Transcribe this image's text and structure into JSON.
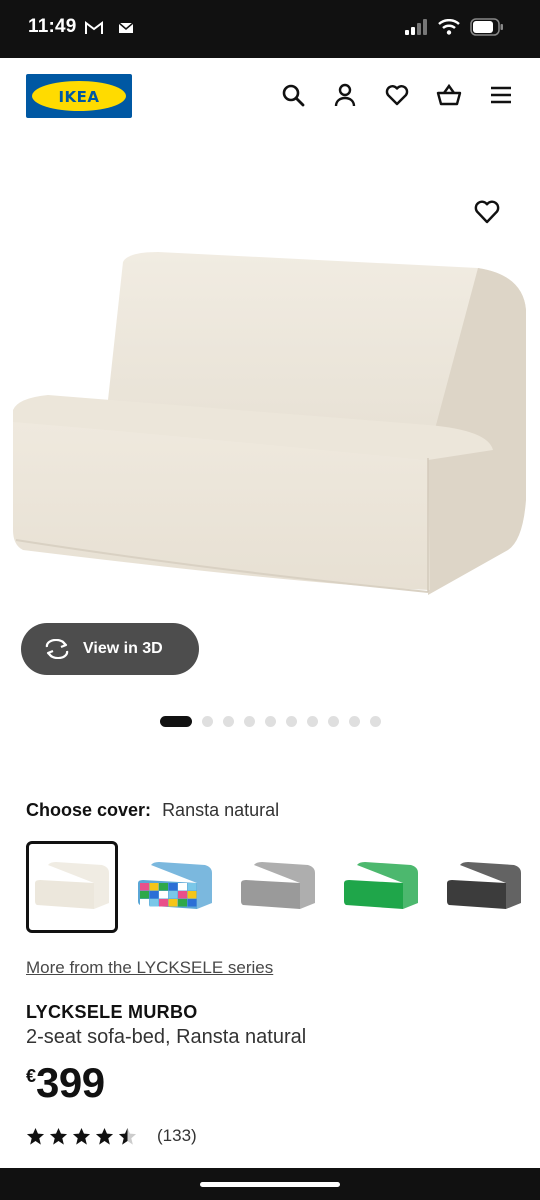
{
  "status_bar": {
    "time": "11:49",
    "left_icons": [
      "gmail-icon",
      "mail-icon"
    ],
    "right_icons": [
      "signal-icon",
      "wifi-icon",
      "battery-icon"
    ]
  },
  "header": {
    "logo_text": "IKEA",
    "icons": [
      "search-icon",
      "account-icon",
      "favorites-icon",
      "basket-icon",
      "menu-icon"
    ]
  },
  "hero": {
    "view3d_label": "View in 3D",
    "carousel": {
      "total": 10,
      "active": 1
    }
  },
  "cover": {
    "label": "Choose cover:",
    "value": "Ransta natural",
    "options": [
      {
        "name": "Ransta natural",
        "color": "#ece7dc",
        "selected": true
      },
      {
        "name": "multicolour",
        "color": "#5aa6d6",
        "selected": false
      },
      {
        "name": "grey",
        "color": "#9a9a9a",
        "selected": false
      },
      {
        "name": "green",
        "color": "#1fa64a",
        "selected": false
      },
      {
        "name": "dark grey",
        "color": "#3c3c3c",
        "selected": false
      }
    ]
  },
  "product": {
    "series_link": "More from the LYCKSELE series",
    "name": "LYCKSELE MURBO",
    "description": "2-seat sofa-bed, Ransta natural",
    "currency": "€",
    "price": "399",
    "rating": 4.5,
    "rating_count": "(133)"
  },
  "colors": {
    "ikea_blue": "#0058a3",
    "ikea_yellow": "#ffdb00",
    "button_grey": "#4d4d4d"
  }
}
